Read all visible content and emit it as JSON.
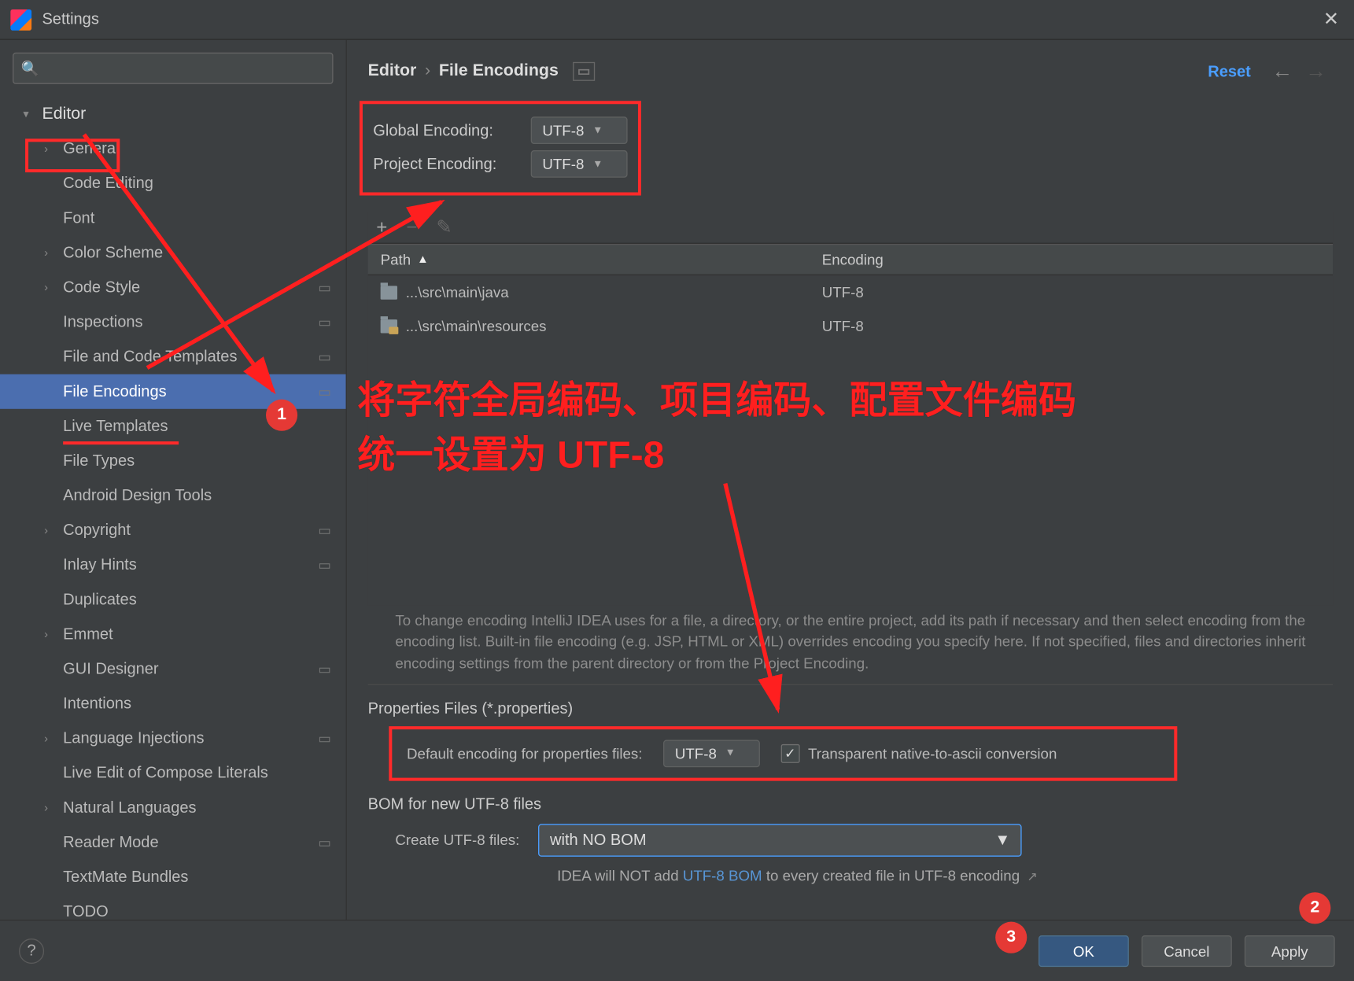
{
  "window": {
    "title": "Settings"
  },
  "search": {
    "placeholder": ""
  },
  "sidebar": {
    "root": "Editor",
    "items": [
      {
        "label": "General",
        "chevron": true,
        "proj": false
      },
      {
        "label": "Code Editing",
        "chevron": false,
        "proj": false
      },
      {
        "label": "Font",
        "chevron": false,
        "proj": false
      },
      {
        "label": "Color Scheme",
        "chevron": true,
        "proj": false
      },
      {
        "label": "Code Style",
        "chevron": true,
        "proj": true
      },
      {
        "label": "Inspections",
        "chevron": false,
        "proj": true
      },
      {
        "label": "File and Code Templates",
        "chevron": false,
        "proj": true
      },
      {
        "label": "File Encodings",
        "chevron": false,
        "proj": true,
        "selected": true
      },
      {
        "label": "Live Templates",
        "chevron": false,
        "proj": false
      },
      {
        "label": "File Types",
        "chevron": false,
        "proj": false
      },
      {
        "label": "Android Design Tools",
        "chevron": false,
        "proj": false
      },
      {
        "label": "Copyright",
        "chevron": true,
        "proj": true
      },
      {
        "label": "Inlay Hints",
        "chevron": false,
        "proj": true
      },
      {
        "label": "Duplicates",
        "chevron": false,
        "proj": false
      },
      {
        "label": "Emmet",
        "chevron": true,
        "proj": false
      },
      {
        "label": "GUI Designer",
        "chevron": false,
        "proj": true
      },
      {
        "label": "Intentions",
        "chevron": false,
        "proj": false
      },
      {
        "label": "Language Injections",
        "chevron": true,
        "proj": true
      },
      {
        "label": "Live Edit of Compose Literals",
        "chevron": false,
        "proj": false
      },
      {
        "label": "Natural Languages",
        "chevron": true,
        "proj": false
      },
      {
        "label": "Reader Mode",
        "chevron": false,
        "proj": true
      },
      {
        "label": "TextMate Bundles",
        "chevron": false,
        "proj": false
      },
      {
        "label": "TODO",
        "chevron": false,
        "proj": false
      }
    ]
  },
  "breadcrumb": {
    "root": "Editor",
    "sep": "›",
    "leaf": "File Encodings"
  },
  "actions": {
    "reset": "Reset"
  },
  "encoding": {
    "global_label": "Global Encoding:",
    "global_value": "UTF-8",
    "project_label": "Project Encoding:",
    "project_value": "UTF-8"
  },
  "table": {
    "col_path": "Path",
    "col_enc": "Encoding",
    "rows": [
      {
        "path": "...\\src\\main\\java",
        "encoding": "UTF-8"
      },
      {
        "path": "...\\src\\main\\resources",
        "encoding": "UTF-8"
      }
    ]
  },
  "help_text": "To change encoding IntelliJ IDEA uses for a file, a directory, or the entire project, add its path if necessary and then select encoding from the encoding list. Built-in file encoding (e.g. JSP, HTML or XML) overrides encoding you specify here. If not specified, files and directories inherit encoding settings from the parent directory or from the Project Encoding.",
  "props": {
    "section": "Properties Files (*.properties)",
    "label": "Default encoding for properties files:",
    "value": "UTF-8",
    "checkbox_label": "Transparent native-to-ascii conversion",
    "checked": true
  },
  "bom": {
    "section": "BOM for new UTF-8 files",
    "label": "Create UTF-8 files:",
    "value": "with NO BOM",
    "note_pre": "IDEA will NOT add ",
    "note_link": "UTF-8 BOM",
    "note_post": " to every created file in UTF-8 encoding"
  },
  "footer": {
    "ok": "OK",
    "cancel": "Cancel",
    "apply": "Apply"
  },
  "annotation": {
    "line1": "将字符全局编码、项目编码、配置文件编码",
    "line2": "统一设置为 UTF-8",
    "badge1": "1",
    "badge2": "2",
    "badge3": "3"
  }
}
